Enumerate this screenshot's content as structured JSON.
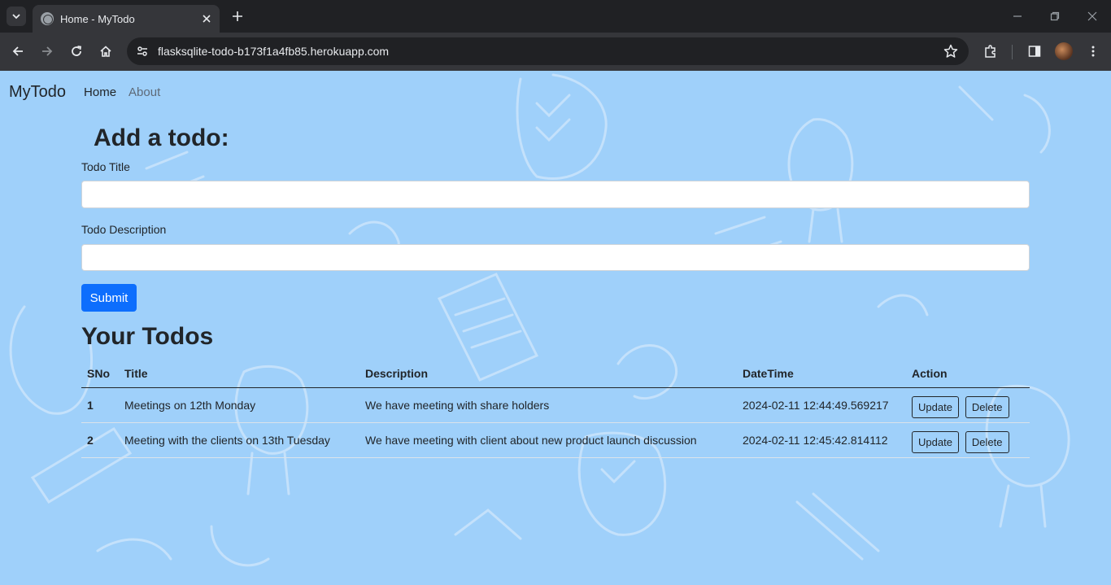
{
  "browser": {
    "tab_title": "Home - MyTodo",
    "url": "flasksqlite-todo-b173f1a4fb85.herokuapp.com"
  },
  "nav": {
    "brand": "MyTodo",
    "links": [
      "Home",
      "About"
    ]
  },
  "form": {
    "heading": "Add a todo:",
    "title_label": "Todo Title",
    "title_value": "",
    "desc_label": "Todo Description",
    "desc_value": "",
    "submit_label": "Submit"
  },
  "todos": {
    "heading": "Your Todos",
    "columns": [
      "SNo",
      "Title",
      "Description",
      "DateTime",
      "Action"
    ],
    "rows": [
      {
        "sno": "1",
        "title": "Meetings on 12th Monday",
        "description": "We have meeting with share holders",
        "datetime": "2024-02-11 12:44:49.569217",
        "update_label": "Update",
        "delete_label": "Delete"
      },
      {
        "sno": "2",
        "title": "Meeting with the clients on 13th Tuesday",
        "description": "We have meeting with client about new product launch discussion",
        "datetime": "2024-02-11 12:45:42.814112",
        "update_label": "Update",
        "delete_label": "Delete"
      }
    ]
  },
  "colors": {
    "page_bg": "#9fd0fa",
    "primary": "#0d6efd",
    "chrome_dark": "#202124",
    "chrome_toolbar": "#35363a"
  },
  "icons": {
    "tab_search": "chevron-down-icon",
    "favicon": "globe-icon",
    "tab_close": "close-icon",
    "new_tab": "plus-icon",
    "back": "arrow-left-icon",
    "forward": "arrow-right-icon",
    "reload": "reload-icon",
    "home": "home-icon",
    "site_info": "tune-icon",
    "bookmark": "star-icon",
    "extensions": "puzzle-icon",
    "side_panel": "side-panel-icon",
    "menu": "kebab-menu-icon"
  }
}
